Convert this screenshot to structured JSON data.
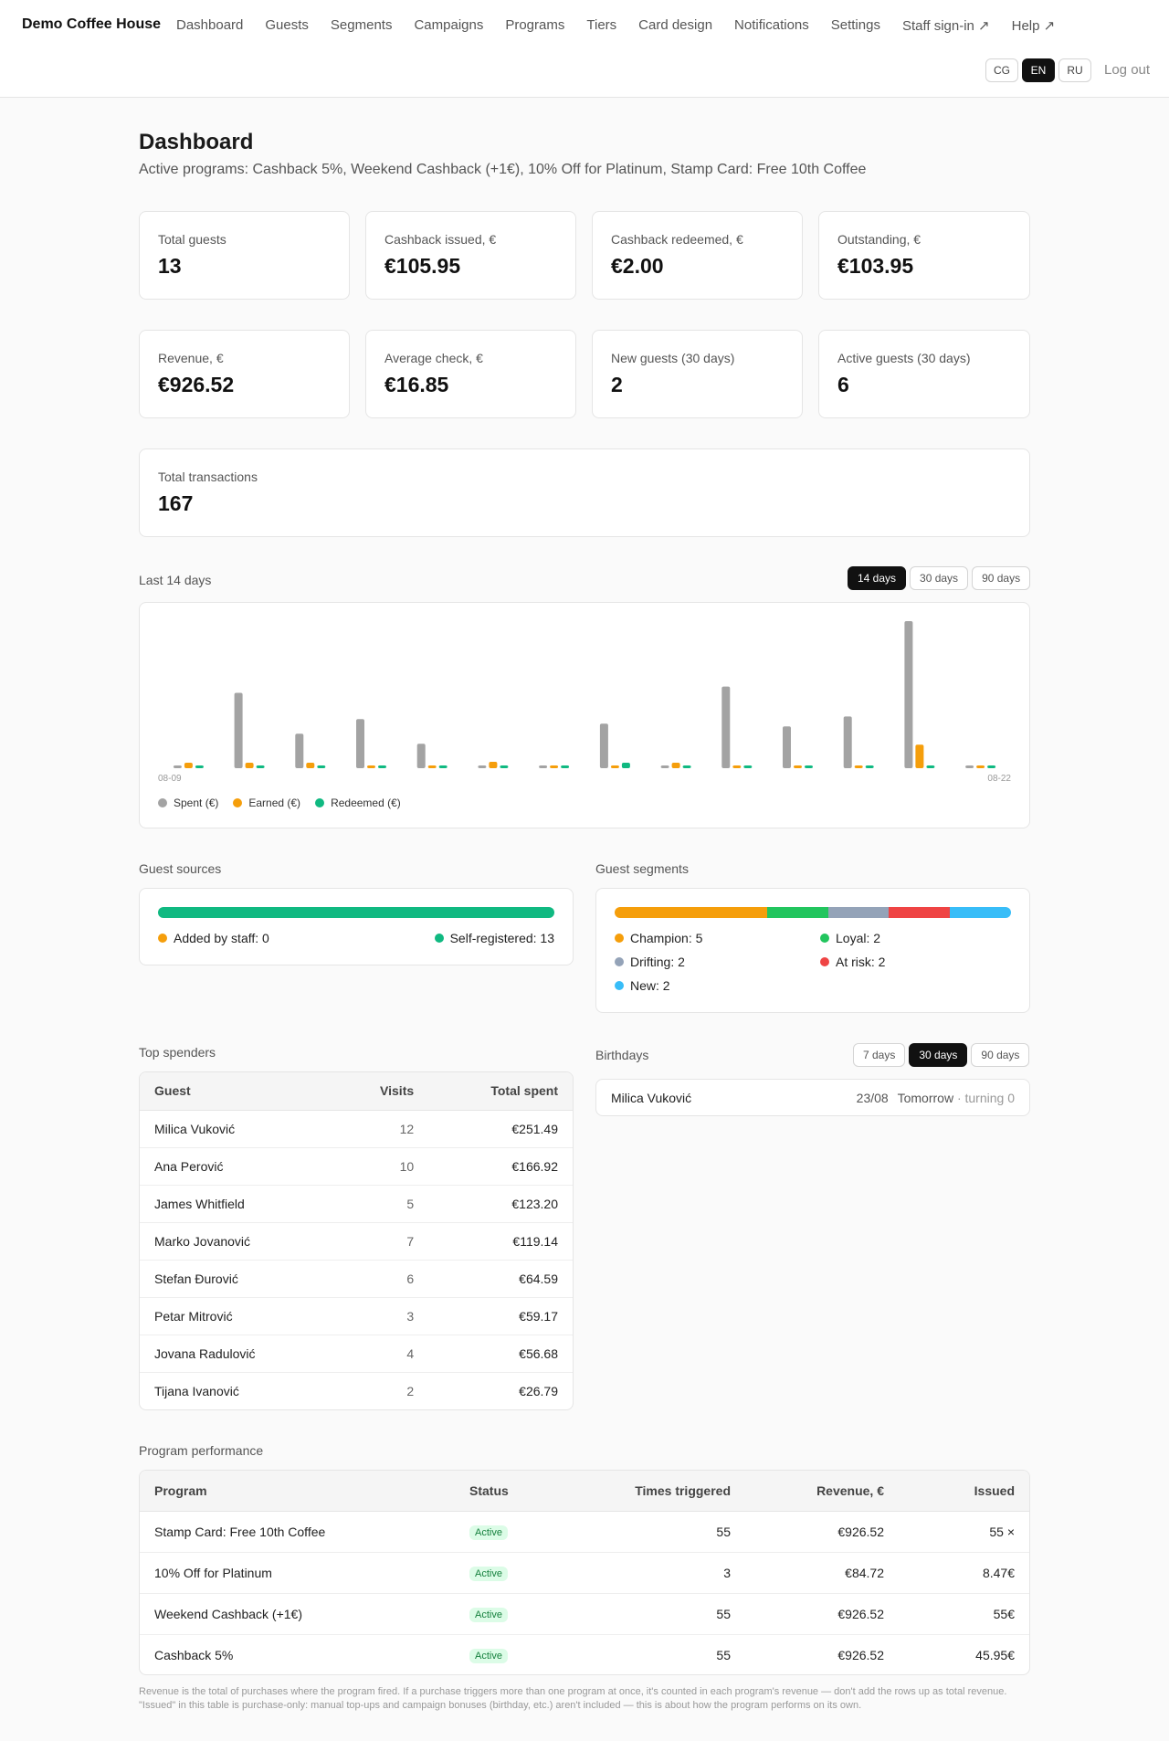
{
  "header": {
    "brand": "Demo Coffee House",
    "nav": [
      "Dashboard",
      "Guests",
      "Segments",
      "Campaigns",
      "Programs",
      "Tiers",
      "Card design",
      "Notifications",
      "Settings",
      "Staff sign-in ↗",
      "Help ↗"
    ],
    "langs": [
      {
        "label": "CG",
        "active": false
      },
      {
        "label": "EN",
        "active": true
      },
      {
        "label": "RU",
        "active": false
      }
    ],
    "logout": "Log out"
  },
  "page": {
    "title": "Dashboard",
    "subtitle": "Active programs: Cashback 5%, Weekend Cashback (+1€), 10% Off for Platinum, Stamp Card: Free 10th Coffee"
  },
  "stats": [
    {
      "label": "Total guests",
      "value": "13"
    },
    {
      "label": "Cashback issued, €",
      "value": "€105.95"
    },
    {
      "label": "Cashback redeemed, €",
      "value": "€2.00"
    },
    {
      "label": "Outstanding, €",
      "value": "€103.95"
    },
    {
      "label": "Revenue, €",
      "value": "€926.52"
    },
    {
      "label": "Average check, €",
      "value": "€16.85"
    },
    {
      "label": "New guests (30 days)",
      "value": "2"
    },
    {
      "label": "Active guests (30 days)",
      "value": "6"
    },
    {
      "label": "Total transactions",
      "value": "167"
    }
  ],
  "activity": {
    "title": "Last 14 days",
    "ranges": [
      {
        "label": "14 days",
        "active": true
      },
      {
        "label": "30 days",
        "active": false
      },
      {
        "label": "90 days",
        "active": false
      }
    ]
  },
  "chart_data": {
    "type": "bar",
    "categories": [
      "08-09",
      "08-10",
      "08-11",
      "08-12",
      "08-13",
      "08-14",
      "08-15",
      "08-16",
      "08-17",
      "08-18",
      "08-19",
      "08-20",
      "08-21",
      "08-22"
    ],
    "tick_labels": [
      "08-09",
      "08-22"
    ],
    "series": [
      {
        "name": "Spent (€)",
        "color": "#a3a3a3",
        "values": [
          2,
          83,
          38,
          54,
          27,
          2,
          2,
          49,
          2,
          90,
          46,
          57,
          162,
          2
        ]
      },
      {
        "name": "Earned (€)",
        "color": "#f59e0b",
        "values": [
          6,
          6,
          6,
          3,
          3,
          7,
          3,
          3,
          6,
          3,
          3,
          3,
          26,
          3
        ]
      },
      {
        "name": "Redeemed (€)",
        "color": "#10b981",
        "values": [
          3,
          3,
          3,
          3,
          3,
          3,
          3,
          6,
          3,
          3,
          3,
          3,
          3,
          3
        ]
      }
    ],
    "ylim": [
      0,
      162
    ]
  },
  "sources": {
    "title": "Guest sources",
    "items": [
      {
        "label": "Added by staff: 0",
        "color": "#f59e0b",
        "fraction": 0
      },
      {
        "label": "Self-registered: 13",
        "color": "#10b981",
        "fraction": 1
      }
    ]
  },
  "segments": {
    "title": "Guest segments",
    "items": [
      {
        "label": "Champion: 5",
        "color": "#f59e0b",
        "count": 5
      },
      {
        "label": "Loyal: 2",
        "color": "#22c55e",
        "count": 2
      },
      {
        "label": "Drifting: 2",
        "color": "#94a3b8",
        "count": 2
      },
      {
        "label": "At risk: 2",
        "color": "#ef4444",
        "count": 2
      },
      {
        "label": "New: 2",
        "color": "#38bdf8",
        "count": 2
      }
    ]
  },
  "spenders": {
    "title": "Top spenders",
    "columns": [
      "Guest",
      "Visits",
      "Total spent"
    ],
    "rows": [
      [
        "Milica Vuković",
        "12",
        "€251.49"
      ],
      [
        "Ana Perović",
        "10",
        "€166.92"
      ],
      [
        "James Whitfield",
        "5",
        "€123.20"
      ],
      [
        "Marko Jovanović",
        "7",
        "€119.14"
      ],
      [
        "Stefan Đurović",
        "6",
        "€64.59"
      ],
      [
        "Petar Mitrović",
        "3",
        "€59.17"
      ],
      [
        "Jovana Radulović",
        "4",
        "€56.68"
      ],
      [
        "Tijana Ivanović",
        "2",
        "€26.79"
      ]
    ]
  },
  "birthdays": {
    "title": "Birthdays",
    "ranges": [
      {
        "label": "7 days",
        "active": false
      },
      {
        "label": "30 days",
        "active": true
      },
      {
        "label": "90 days",
        "active": false
      }
    ],
    "items": [
      {
        "name": "Milica Vuković",
        "date": "23/08",
        "when": "Tomorrow",
        "age": "· turning 0"
      }
    ]
  },
  "programs": {
    "title": "Program performance",
    "columns": [
      "Program",
      "Status",
      "Times triggered",
      "Revenue, €",
      "Issued"
    ],
    "rows": [
      [
        "Stamp Card: Free 10th Coffee",
        "Active",
        "55",
        "€926.52",
        "55 ×"
      ],
      [
        "10% Off for Platinum",
        "Active",
        "3",
        "€84.72",
        "8.47€"
      ],
      [
        "Weekend Cashback (+1€)",
        "Active",
        "55",
        "€926.52",
        "55€"
      ],
      [
        "Cashback 5%",
        "Active",
        "55",
        "€926.52",
        "45.95€"
      ]
    ],
    "note": "Revenue is the total of purchases where the program fired. If a purchase triggers more than one program at once, it's counted in each program's revenue — don't add the rows up as total revenue. \"Issued\" in this table is purchase-only: manual top-ups and campaign bonuses (birthday, etc.) aren't included — this is about how the program performs on its own."
  }
}
